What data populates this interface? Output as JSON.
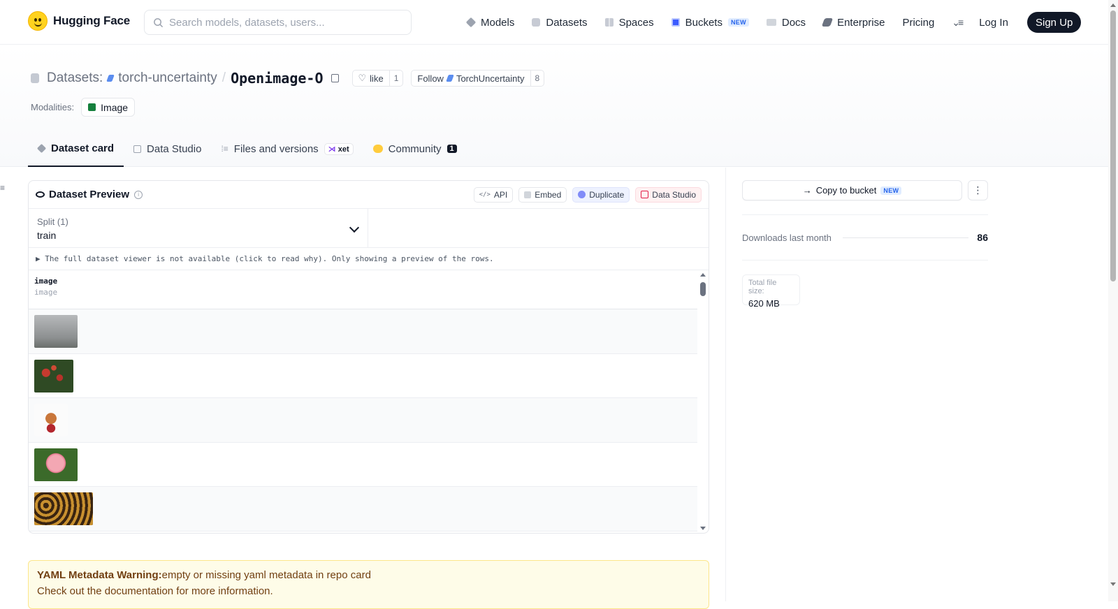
{
  "topbar": {
    "brand": "Hugging Face",
    "search_placeholder": "Search models, datasets, users...",
    "nav": [
      {
        "label": "Models",
        "icon": "cube-icon"
      },
      {
        "label": "Datasets",
        "icon": "database-icon"
      },
      {
        "label": "Spaces",
        "icon": "spaces-icon"
      },
      {
        "label": "Buckets",
        "icon": "bucket-icon",
        "badge": "NEW"
      },
      {
        "label": "Docs",
        "icon": "book-icon"
      },
      {
        "label": "Enterprise",
        "icon": "enterprise-icon"
      },
      {
        "label": "Pricing"
      }
    ],
    "login": "Log In",
    "signup": "Sign Up"
  },
  "repo": {
    "type_label": "Datasets:",
    "owner": "torch-uncertainty",
    "separator": "/",
    "name": "Openimage-O",
    "like_label": "like",
    "like_count": "1",
    "follow_label": "Follow",
    "follow_org": "TorchUncertainty",
    "follow_count": "8",
    "modalities_label": "Modalities:",
    "modality": "Image"
  },
  "tabs": [
    {
      "label": "Dataset card",
      "active": true
    },
    {
      "label": "Data Studio"
    },
    {
      "label": "Files and versions",
      "badge": "xet"
    },
    {
      "label": "Community",
      "badge": "1"
    }
  ],
  "preview": {
    "title": "Dataset Preview",
    "actions": [
      "API",
      "Embed",
      "Duplicate",
      "Data Studio"
    ],
    "split_label": "Split (1)",
    "split_value": "train",
    "notice": "▶ The full dataset viewer is not available (click to read why). Only showing a preview of the rows.",
    "column_name": "image",
    "column_type": "image"
  },
  "yaml_warning": {
    "title": "YAML Metadata Warning:",
    "message": "empty or missing yaml metadata in repo card",
    "second_line": "Check out the documentation for more information."
  },
  "sidebar": {
    "copy_label": "Copy to bucket",
    "copy_badge": "NEW",
    "downloads_label": "Downloads last month",
    "downloads_value": "86",
    "size_label": "Total file size:",
    "size_value": "620 MB"
  }
}
